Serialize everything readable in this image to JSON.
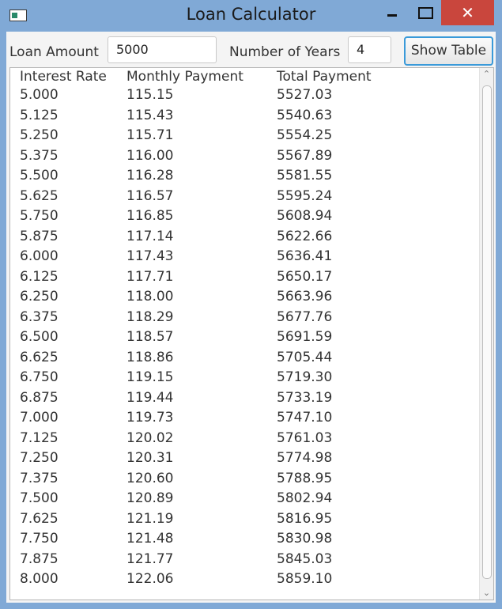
{
  "window": {
    "title": "Loan Calculator",
    "close_glyph": "✕",
    "icon": "app-window-icon",
    "close_color": "#c9463d",
    "border_color": "#80a9d6"
  },
  "toolbar": {
    "loan_amount_label": "Loan Amount",
    "loan_amount_value": "5000",
    "years_label": "Number of Years",
    "years_value": "4",
    "show_table_label": "Show Table"
  },
  "table": {
    "headers": [
      "Interest Rate",
      "Monthly Payment",
      "Total Payment"
    ],
    "rows": [
      [
        "5.000",
        "115.15",
        "5527.03"
      ],
      [
        "5.125",
        "115.43",
        "5540.63"
      ],
      [
        "5.250",
        "115.71",
        "5554.25"
      ],
      [
        "5.375",
        "116.00",
        "5567.89"
      ],
      [
        "5.500",
        "116.28",
        "5581.55"
      ],
      [
        "5.625",
        "116.57",
        "5595.24"
      ],
      [
        "5.750",
        "116.85",
        "5608.94"
      ],
      [
        "5.875",
        "117.14",
        "5622.66"
      ],
      [
        "6.000",
        "117.43",
        "5636.41"
      ],
      [
        "6.125",
        "117.71",
        "5650.17"
      ],
      [
        "6.250",
        "118.00",
        "5663.96"
      ],
      [
        "6.375",
        "118.29",
        "5677.76"
      ],
      [
        "6.500",
        "118.57",
        "5691.59"
      ],
      [
        "6.625",
        "118.86",
        "5705.44"
      ],
      [
        "6.750",
        "119.15",
        "5719.30"
      ],
      [
        "6.875",
        "119.44",
        "5733.19"
      ],
      [
        "7.000",
        "119.73",
        "5747.10"
      ],
      [
        "7.125",
        "120.02",
        "5761.03"
      ],
      [
        "7.250",
        "120.31",
        "5774.98"
      ],
      [
        "7.375",
        "120.60",
        "5788.95"
      ],
      [
        "7.500",
        "120.89",
        "5802.94"
      ],
      [
        "7.625",
        "121.19",
        "5816.95"
      ],
      [
        "7.750",
        "121.48",
        "5830.98"
      ],
      [
        "7.875",
        "121.77",
        "5845.03"
      ],
      [
        "8.000",
        "122.06",
        "5859.10"
      ]
    ]
  },
  "scrollbar": {
    "up_glyph": "⌃",
    "down_glyph": "⌄"
  }
}
